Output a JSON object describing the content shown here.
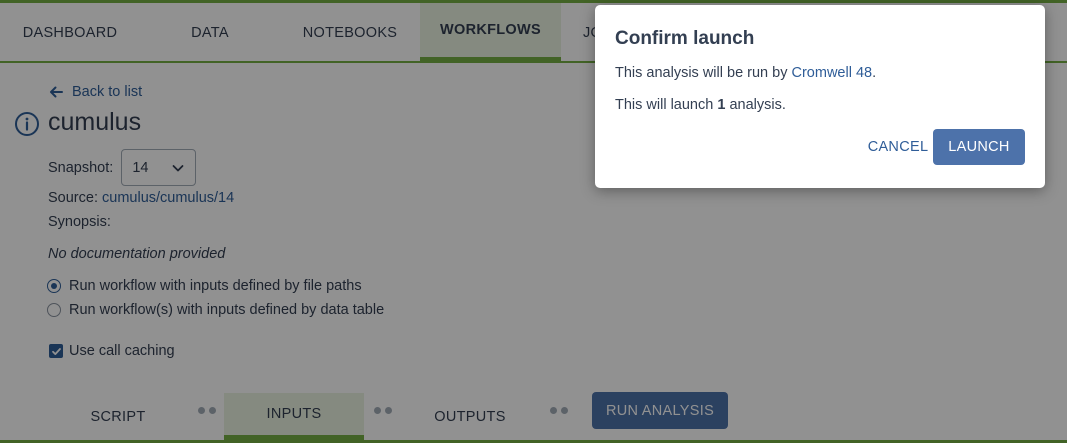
{
  "colors": {
    "accent_green": "#74ae43",
    "link_blue": "#2f5d98",
    "primary_button": "#4d72aa",
    "overlay": "rgba(0,0,0,0.43)"
  },
  "nav": {
    "tabs": [
      {
        "label": "DASHBOARD",
        "active": false
      },
      {
        "label": "DATA",
        "active": false
      },
      {
        "label": "NOTEBOOKS",
        "active": false
      },
      {
        "label": "WORKFLOWS",
        "active": true
      },
      {
        "label": "JO",
        "active": false
      }
    ]
  },
  "workflow": {
    "back_label": "Back to list",
    "name": "cumulus",
    "snapshot_label": "Snapshot:",
    "snapshot_value": "14",
    "source_label": "Source:",
    "source_value": "cumulus/cumulus/14",
    "synopsis_label": "Synopsis:",
    "no_doc": "No documentation provided",
    "options": [
      {
        "label": "Run workflow with inputs defined by file paths",
        "selected": true
      },
      {
        "label": "Run workflow(s) with inputs defined by data table",
        "selected": false
      }
    ],
    "call_caching": {
      "label": "Use call caching",
      "checked": true
    }
  },
  "steps": {
    "tabs": [
      {
        "label": "SCRIPT",
        "active": false
      },
      {
        "label": "INPUTS",
        "active": true
      },
      {
        "label": "OUTPUTS",
        "active": false
      }
    ],
    "run_label": "RUN ANALYSIS"
  },
  "modal": {
    "title": "Confirm launch",
    "line1_prefix": "This analysis will be run by ",
    "line1_link": "Cromwell 48",
    "line1_suffix": ".",
    "line2_prefix": "This will launch ",
    "line2_count": "1",
    "line2_suffix": " analysis.",
    "cancel_label": "CANCEL",
    "launch_label": "LAUNCH"
  }
}
